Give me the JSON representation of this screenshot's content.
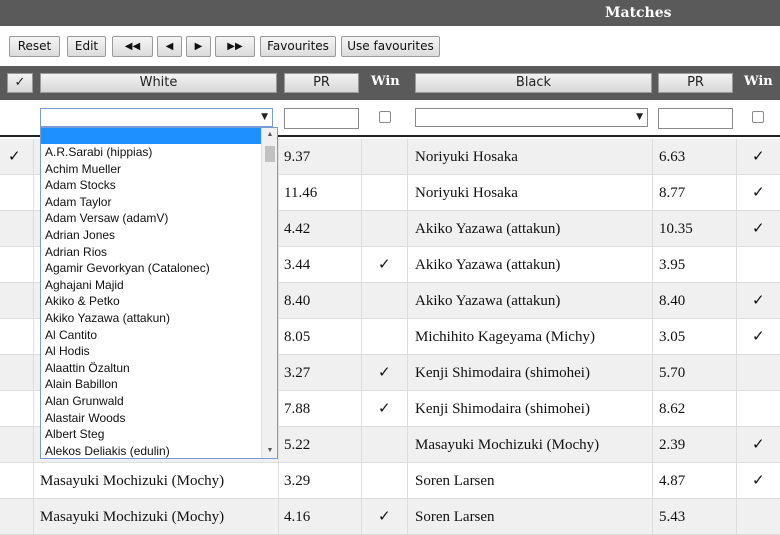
{
  "title": "Matches",
  "toolbar": {
    "reset": "Reset",
    "edit": "Edit",
    "first": "◀◀",
    "prev": "◀",
    "next": "▶",
    "last": "▶▶",
    "favourites": "Favourites",
    "use_favourites": "Use favourites"
  },
  "header": {
    "check": "✓",
    "white": "White",
    "pr_white": "PR",
    "win_white": "Win",
    "black": "Black",
    "pr_black": "PR",
    "win_black": "Win"
  },
  "filters": {
    "white_selected": "",
    "pr_white": "",
    "black_selected": "",
    "pr_black": ""
  },
  "dropdown_options": [
    "A.R.Sarabi (hippias)",
    "Achim Mueller",
    "Adam Stocks",
    "Adam Taylor",
    "Adam Versaw (adamV)",
    "Adrian Jones",
    "Adrian Rios",
    "Agamir Gevorkyan (Catalonec)",
    "Aghajani Majid",
    "Akiko & Petko",
    "Akiko Yazawa (attakun)",
    "Al Cantito",
    "Al Hodis",
    "Alaattin Özaltun",
    "Alain Babillon",
    "Alan Grunwald",
    "Alastair Woods",
    "Albert Steg",
    "Alekos Deliakis (edulin)"
  ],
  "rows": [
    {
      "check": "✓",
      "white": "",
      "pr_white": "9.37",
      "win_white": "",
      "black": "Noriyuki Hosaka",
      "pr_black": "6.63",
      "win_black": "✓"
    },
    {
      "check": "",
      "white": "",
      "pr_white": "11.46",
      "win_white": "",
      "black": "Noriyuki Hosaka",
      "pr_black": "8.77",
      "win_black": "✓"
    },
    {
      "check": "",
      "white": "",
      "pr_white": "4.42",
      "win_white": "",
      "black": "Akiko Yazawa (attakun)",
      "pr_black": "10.35",
      "win_black": "✓"
    },
    {
      "check": "",
      "white": "",
      "pr_white": "3.44",
      "win_white": "✓",
      "black": "Akiko Yazawa (attakun)",
      "pr_black": "3.95",
      "win_black": ""
    },
    {
      "check": "",
      "white": "",
      "pr_white": "8.40",
      "win_white": "",
      "black": "Akiko Yazawa (attakun)",
      "pr_black": "8.40",
      "win_black": "✓"
    },
    {
      "check": "",
      "white": "",
      "pr_white": "8.05",
      "win_white": "",
      "black": "Michihito Kageyama (Michy)",
      "pr_black": "3.05",
      "win_black": "✓"
    },
    {
      "check": "",
      "white": "",
      "pr_white": "3.27",
      "win_white": "✓",
      "black": "Kenji Shimodaira (shimohei)",
      "pr_black": "5.70",
      "win_black": ""
    },
    {
      "check": "",
      "white": "",
      "pr_white": "7.88",
      "win_white": "✓",
      "black": "Kenji Shimodaira (shimohei)",
      "pr_black": "8.62",
      "win_black": ""
    },
    {
      "check": "",
      "white": "",
      "pr_white": "5.22",
      "win_white": "",
      "black": "Masayuki Mochizuki (Mochy)",
      "pr_black": "2.39",
      "win_black": "✓"
    },
    {
      "check": "",
      "white": "Masayuki Mochizuki (Mochy)",
      "pr_white": "3.29",
      "win_white": "",
      "black": "Soren Larsen",
      "pr_black": "4.87",
      "win_black": "✓"
    },
    {
      "check": "",
      "white": "Masayuki Mochizuki (Mochy)",
      "pr_white": "4.16",
      "win_white": "✓",
      "black": "Soren Larsen",
      "pr_black": "5.43",
      "win_black": ""
    }
  ]
}
